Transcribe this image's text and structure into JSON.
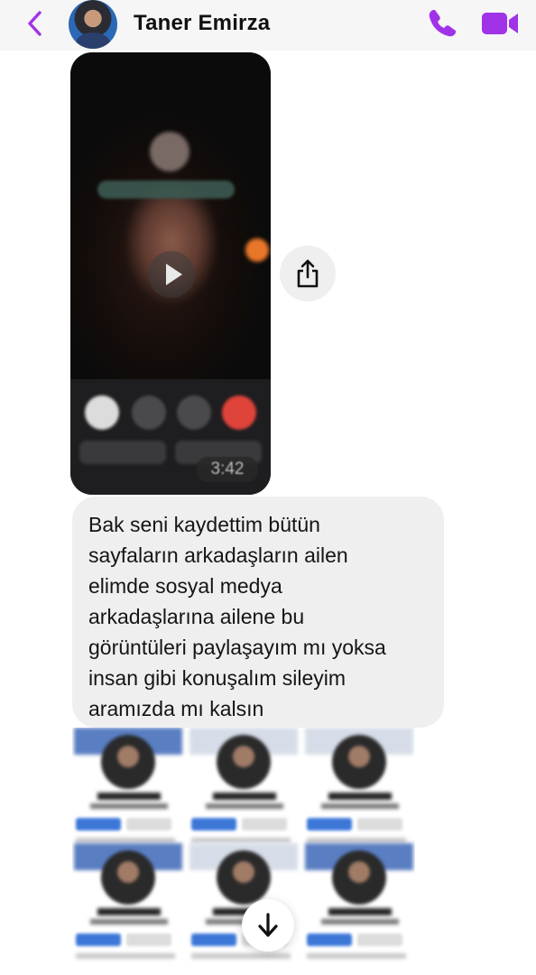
{
  "header": {
    "contact_name": "Taner Emirza",
    "icons": {
      "back": "chevron-left-icon",
      "call": "phone-icon",
      "video": "video-camera-icon"
    },
    "accent_color": "#a033e8"
  },
  "video_message": {
    "duration": "3:42",
    "share_icon": "share-icon",
    "play_icon": "play-icon"
  },
  "text_message": {
    "text": "Bak seni kaydettim bütün\nsayfaların arkadaşların ailen\nelimde sosyal medya\narkadaşlarına ailene bu\ngörüntüleri paylaşayım mı yoksa\ninsan gibi konuşalım sileyim\naramızda mı kalsın"
  },
  "scroll_down": {
    "icon": "arrow-down-icon"
  }
}
